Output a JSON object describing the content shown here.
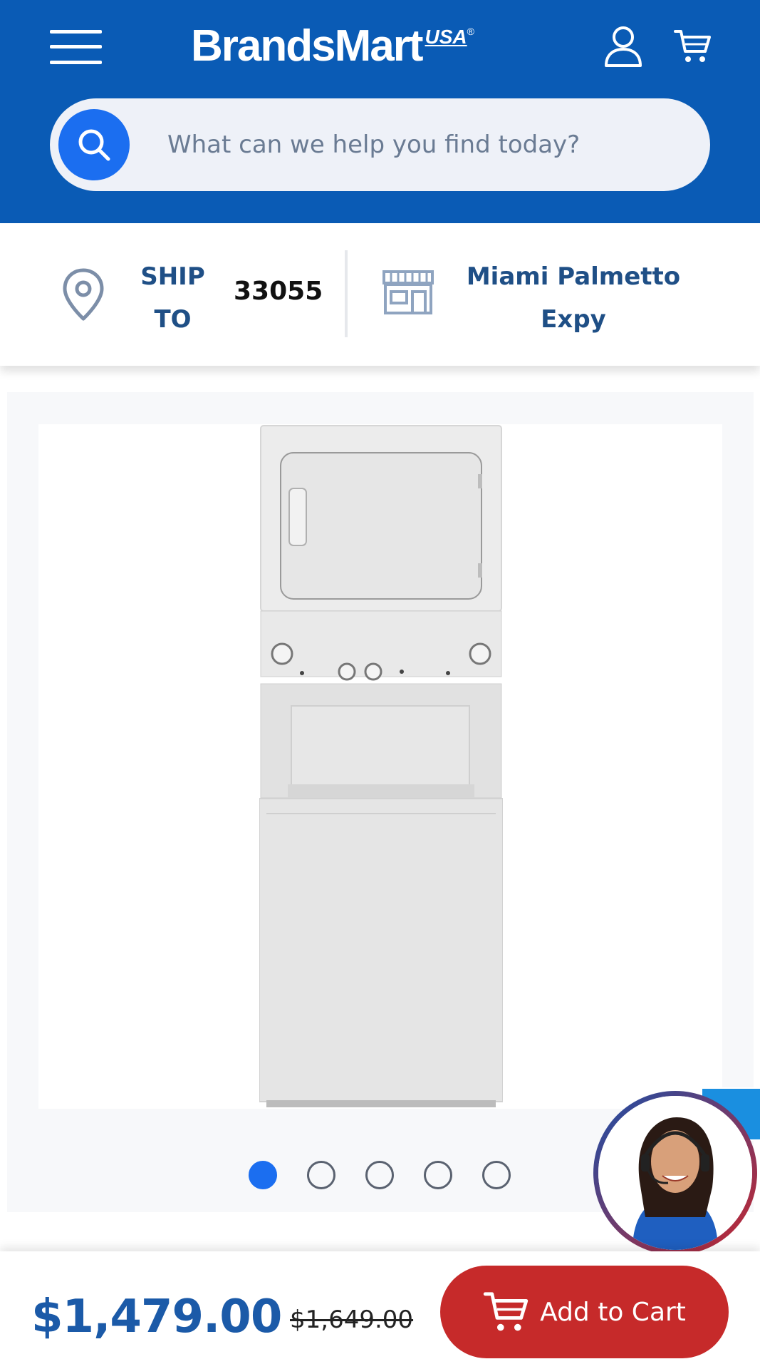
{
  "header": {
    "brand_main": "BrandsMart",
    "brand_usa": "USA",
    "brand_reg": "®",
    "menu_icon": "hamburger-menu-icon",
    "account_icon": "user-icon",
    "cart_icon": "cart-icon",
    "brand_color": "#0a5bb5"
  },
  "search": {
    "placeholder": "What can we help you find today?",
    "value": "",
    "icon": "search-icon"
  },
  "location": {
    "ship_label_line1": "SHIP",
    "ship_label_line2": "TO",
    "zip": "33055",
    "store_line1": "Miami Palmetto",
    "store_line2": "Expy",
    "pin_icon": "location-pin-icon",
    "store_icon": "store-icon"
  },
  "gallery": {
    "slide_count": 5,
    "active_slide": 1,
    "badge": "energy-star-badge"
  },
  "purchase": {
    "price": "$1,479.00",
    "original_price": "$1,649.00",
    "add_to_cart_label": "Add to Cart",
    "button_color": "#c62a2a"
  },
  "chat": {
    "icon": "support-agent-avatar"
  }
}
